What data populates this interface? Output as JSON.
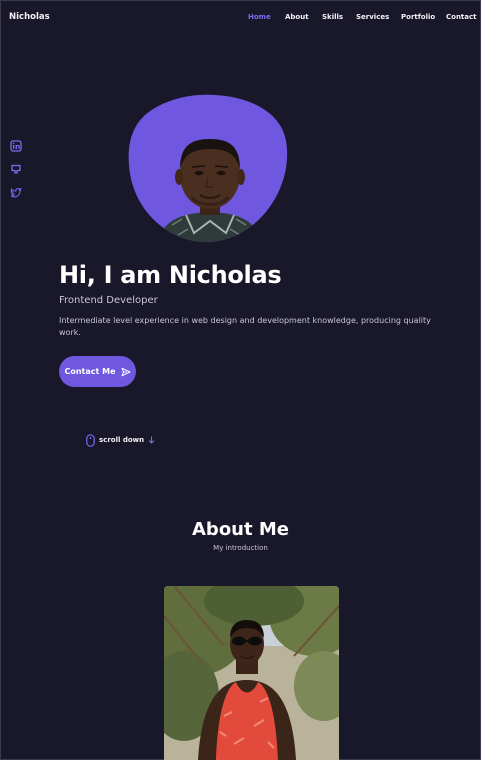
{
  "nav": {
    "brand": "Nicholas",
    "items": [
      {
        "label": "Home",
        "active": true
      },
      {
        "label": "About",
        "active": false
      },
      {
        "label": "Skills",
        "active": false
      },
      {
        "label": "Services",
        "active": false
      },
      {
        "label": "Portfolio",
        "active": false
      },
      {
        "label": "Contact",
        "active": false
      }
    ]
  },
  "social": [
    {
      "icon": "linkedin-icon"
    },
    {
      "icon": "github-icon"
    },
    {
      "icon": "twitter-icon"
    }
  ],
  "hero": {
    "title": "Hi, I am Nicholas",
    "subtitle": "Frontend Developer",
    "description": "Intermediate level experience in web design and development knowledge, producing quality work.",
    "contact_button": "Contact Me",
    "contact_icon": "send-icon",
    "scroll_label": "scroll down",
    "scroll_icons": [
      "mouse-icon",
      "arrow-down-icon"
    ]
  },
  "about": {
    "title": "About Me",
    "subtitle": "My introduction"
  },
  "colors": {
    "background": "#19172a",
    "accent": "#6f57e0",
    "active_nav": "#7c6cf0",
    "text": "#ffffff",
    "muted_text": "#c9c6dc"
  }
}
